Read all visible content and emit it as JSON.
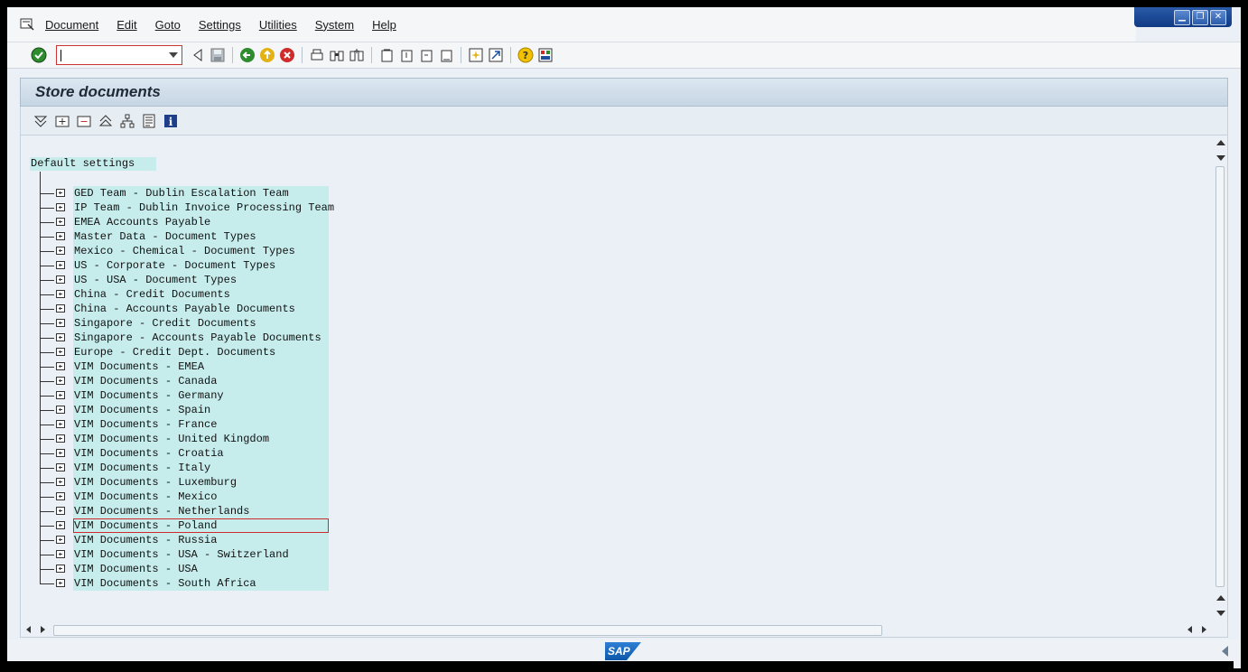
{
  "menubar": {
    "items": [
      "Document",
      "Edit",
      "Goto",
      "Settings",
      "Utilities",
      "System",
      "Help"
    ]
  },
  "toolbar": {
    "command_field_value": ""
  },
  "screen": {
    "title": "Store documents"
  },
  "tree": {
    "root": "Default settings",
    "nodes": [
      "GED Team - Dublin Escalation Team",
      "IP Team - Dublin Invoice Processing Team",
      "EMEA Accounts Payable",
      "Master Data - Document Types",
      "Mexico - Chemical - Document Types",
      "US - Corporate - Document Types",
      "US - USA - Document Types",
      "China - Credit Documents",
      "China - Accounts Payable Documents",
      "Singapore - Credit Documents",
      "Singapore - Accounts Payable Documents",
      "Europe - Credit Dept. Documents",
      "VIM Documents - EMEA",
      "VIM Documents - Canada",
      "VIM Documents - Germany",
      "VIM Documents - Spain",
      "VIM Documents - France",
      "VIM Documents - United Kingdom",
      "VIM Documents - Croatia",
      "VIM Documents - Italy",
      "VIM Documents - Luxemburg",
      "VIM Documents - Mexico",
      "VIM Documents - Netherlands",
      "VIM Documents - Poland",
      "VIM Documents - Russia",
      "VIM Documents - USA - Switzerland",
      "VIM Documents - USA",
      "VIM Documents - South Africa"
    ],
    "selected_index": 23
  },
  "status": {
    "logo": "SAP"
  },
  "colors": {
    "tree_highlight": "#c6ecec",
    "selection_border": "#d12a2a",
    "background": "#eaf0f5"
  }
}
